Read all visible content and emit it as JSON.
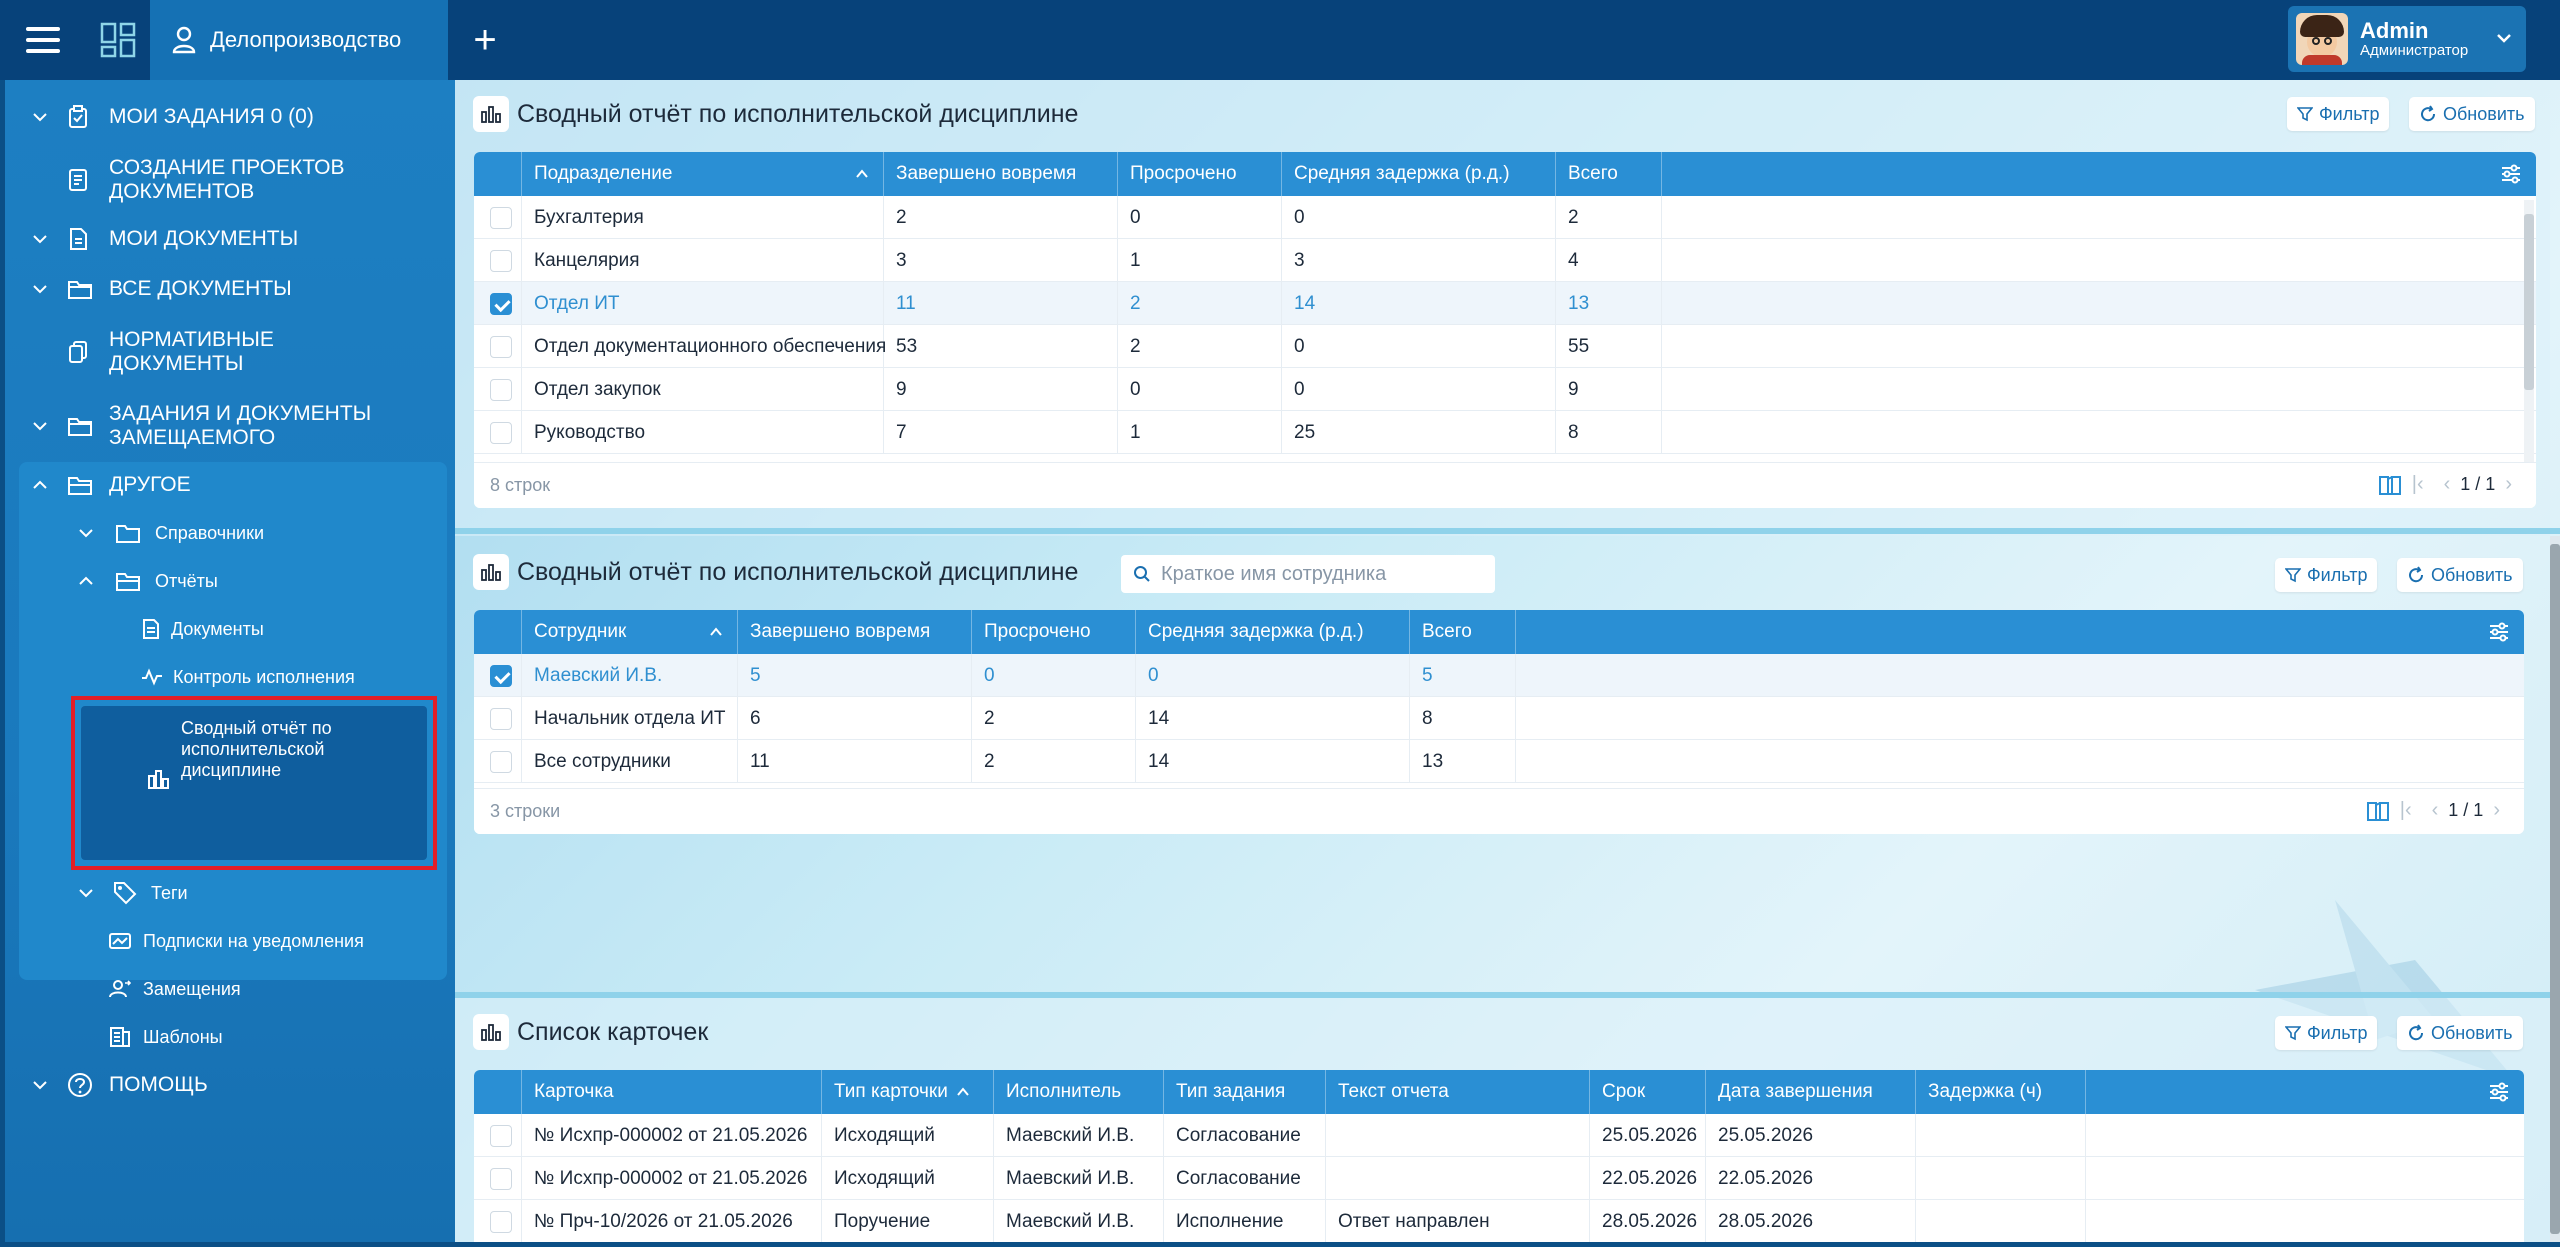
{
  "app": {
    "module": "Делопроизводство",
    "user": {
      "name": "Admin",
      "role": "Администратор"
    }
  },
  "sidebar": {
    "items": [
      {
        "label": "МОИ ЗАДАНИЯ 0 (0)"
      },
      {
        "label": "СОЗДАНИЕ ПРОЕКТОВ\nДОКУМЕНТОВ"
      },
      {
        "label": "МОИ ДОКУМЕНТЫ"
      },
      {
        "label": "ВСЕ ДОКУМЕНТЫ"
      },
      {
        "label": "НОРМАТИВНЫЕ\nДОКУМЕНТЫ"
      },
      {
        "label": "ЗАДАНИЯ И ДОКУМЕНТЫ\nЗАМЕЩАЕМОГО"
      },
      {
        "label": "ДРУГОЕ"
      },
      {
        "label": "ПОМОЩЬ"
      }
    ],
    "other": {
      "references": "Справочники",
      "reports": "Отчёты",
      "documents": "Документы",
      "control": "Контроль исполнения",
      "selected": "Сводный отчёт по\nисполнительской\nдисциплине",
      "tags": "Теги",
      "subscriptions": "Подписки на уведомления",
      "substitutions": "Замещения",
      "templates": "Шаблоны"
    }
  },
  "panel1": {
    "title": "Сводный отчёт по исполнительской дисциплине",
    "filter": "Фильтр",
    "refresh": "Обновить",
    "columns": [
      "Подразделение",
      "Завершено вовремя",
      "Просрочено",
      "Средняя задержка (р.д.)",
      "Всего"
    ],
    "rows": [
      [
        "Бухгалтерия",
        "2",
        "0",
        "0",
        "2"
      ],
      [
        "Канцелярия",
        "3",
        "1",
        "3",
        "4"
      ],
      [
        "Отдел ИТ",
        "11",
        "2",
        "14",
        "13"
      ],
      [
        "Отдел документационного обеспечения",
        "53",
        "2",
        "0",
        "55"
      ],
      [
        "Отдел закупок",
        "9",
        "0",
        "0",
        "9"
      ],
      [
        "Руководство",
        "7",
        "1",
        "25",
        "8"
      ]
    ],
    "count": "8 строк",
    "page": "1 / 1"
  },
  "panel2": {
    "title": "Сводный отчёт по исполнительской дисциплине",
    "search_placeholder": "Краткое имя сотрудника",
    "filter": "Фильтр",
    "refresh": "Обновить",
    "columns": [
      "Сотрудник",
      "Завершено вовремя",
      "Просрочено",
      "Средняя задержка (р.д.)",
      "Всего"
    ],
    "rows": [
      [
        "Маевский И.В.",
        "5",
        "0",
        "0",
        "5"
      ],
      [
        "Начальник отдела ИТ",
        "6",
        "2",
        "14",
        "8"
      ],
      [
        "Все сотрудники",
        "11",
        "2",
        "14",
        "13"
      ]
    ],
    "count": "3 строки",
    "page": "1 / 1"
  },
  "panel3": {
    "title": "Список карточек",
    "filter": "Фильтр",
    "refresh": "Обновить",
    "columns": [
      "Карточка",
      "Тип карточки",
      "Исполнитель",
      "Тип задания",
      "Текст отчета",
      "Срок",
      "Дата завершения",
      "Задержка (ч)"
    ],
    "rows": [
      [
        "№ Исхпр-000002 от 21.05.2026",
        "Исходящий",
        "Маевский И.В.",
        "Согласование",
        "",
        "25.05.2026",
        "25.05.2026",
        ""
      ],
      [
        "№ Исхпр-000002 от 21.05.2026",
        "Исходящий",
        "Маевский И.В.",
        "Согласование",
        "",
        "22.05.2026",
        "22.05.2026",
        ""
      ],
      [
        "№ Прч-10/2026 от 21.05.2026",
        "Поручение",
        "Маевский И.В.",
        "Исполнение",
        "Ответ направлен",
        "28.05.2026",
        "28.05.2026",
        ""
      ]
    ]
  }
}
